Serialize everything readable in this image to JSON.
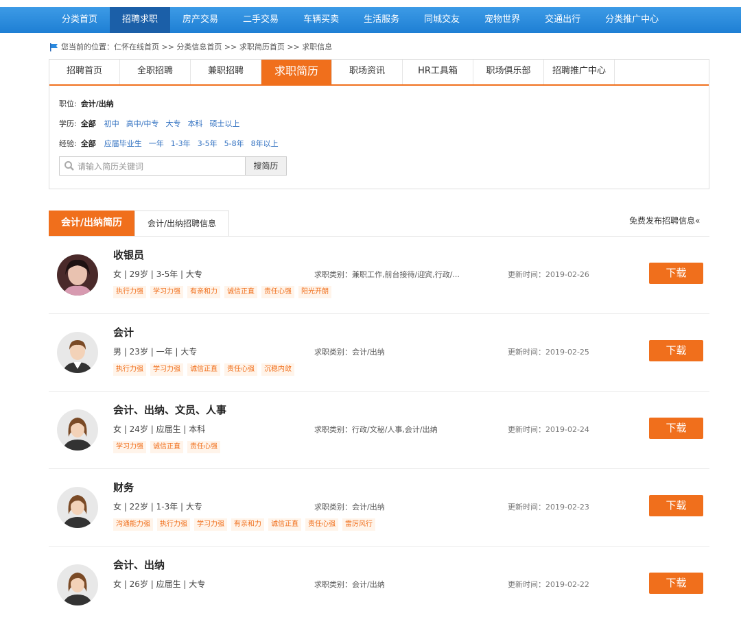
{
  "topnav": [
    "分类首页",
    "招聘求职",
    "房产交易",
    "二手交易",
    "车辆买卖",
    "生活服务",
    "同城交友",
    "宠物世界",
    "交通出行",
    "分类推广中心"
  ],
  "breadcrumb": "您当前的位置：仁怀在线首页 >> 分类信息首页 >> 求职简历首页 >> 求职信息",
  "tabs": [
    "招聘首页",
    "全职招聘",
    "兼职招聘",
    "求职简历",
    "职场资讯",
    "HR工具箱",
    "职场俱乐部",
    "招聘推广中心"
  ],
  "filters": {
    "position_label": "职位:",
    "position_value": "会计/出纳",
    "edu_label": "学历:",
    "edu_selected": "全部",
    "edu_options": [
      "初中",
      "高中/中专",
      "大专",
      "本科",
      "硕士以上"
    ],
    "exp_label": "经验:",
    "exp_selected": "全部",
    "exp_options": [
      "应届毕业生",
      "一年",
      "1-3年",
      "3-5年",
      "5-8年",
      "8年以上"
    ]
  },
  "search": {
    "placeholder": "请输入简历关键词",
    "button": "搜简历"
  },
  "section": {
    "tab1": "会计/出纳简历",
    "tab2": "会计/出纳招聘信息",
    "publish": "免费发布招聘信息«"
  },
  "resumes": [
    {
      "name": "收银员",
      "info": "女 | 29岁 | 3-5年 | 大专",
      "category": "求职类别：兼职工作,前台接待/迎宾,行政/...",
      "updated": "更新时间：2019-02-26",
      "tags": [
        "执行力强",
        "学习力强",
        "有亲和力",
        "诚信正直",
        "责任心强",
        "阳光开朗"
      ],
      "download": "下载"
    },
    {
      "name": "会计",
      "info": "男 | 23岁 | 一年 | 大专",
      "category": "求职类别：会计/出纳",
      "updated": "更新时间：2019-02-25",
      "tags": [
        "执行力强",
        "学习力强",
        "诚信正直",
        "责任心强",
        "沉稳内敛"
      ],
      "download": "下载"
    },
    {
      "name": "会计、出纳、文员、人事",
      "info": "女 | 24岁 | 应届生 | 本科",
      "category": "求职类别：行政/文秘/人事,会计/出纳",
      "updated": "更新时间：2019-02-24",
      "tags": [
        "学习力强",
        "诚信正直",
        "责任心强"
      ],
      "download": "下载"
    },
    {
      "name": "财务",
      "info": "女 | 22岁 | 1-3年 | 大专",
      "category": "求职类别：会计/出纳",
      "updated": "更新时间：2019-02-23",
      "tags": [
        "沟通能力强",
        "执行力强",
        "学习力强",
        "有亲和力",
        "诚信正直",
        "责任心强",
        "雷厉风行"
      ],
      "download": "下载"
    },
    {
      "name": "会计、出纳",
      "info": "女 | 26岁 | 应届生 | 大专",
      "category": "求职类别：会计/出纳",
      "updated": "更新时间：2019-02-22",
      "tags": [],
      "download": "下载"
    }
  ]
}
